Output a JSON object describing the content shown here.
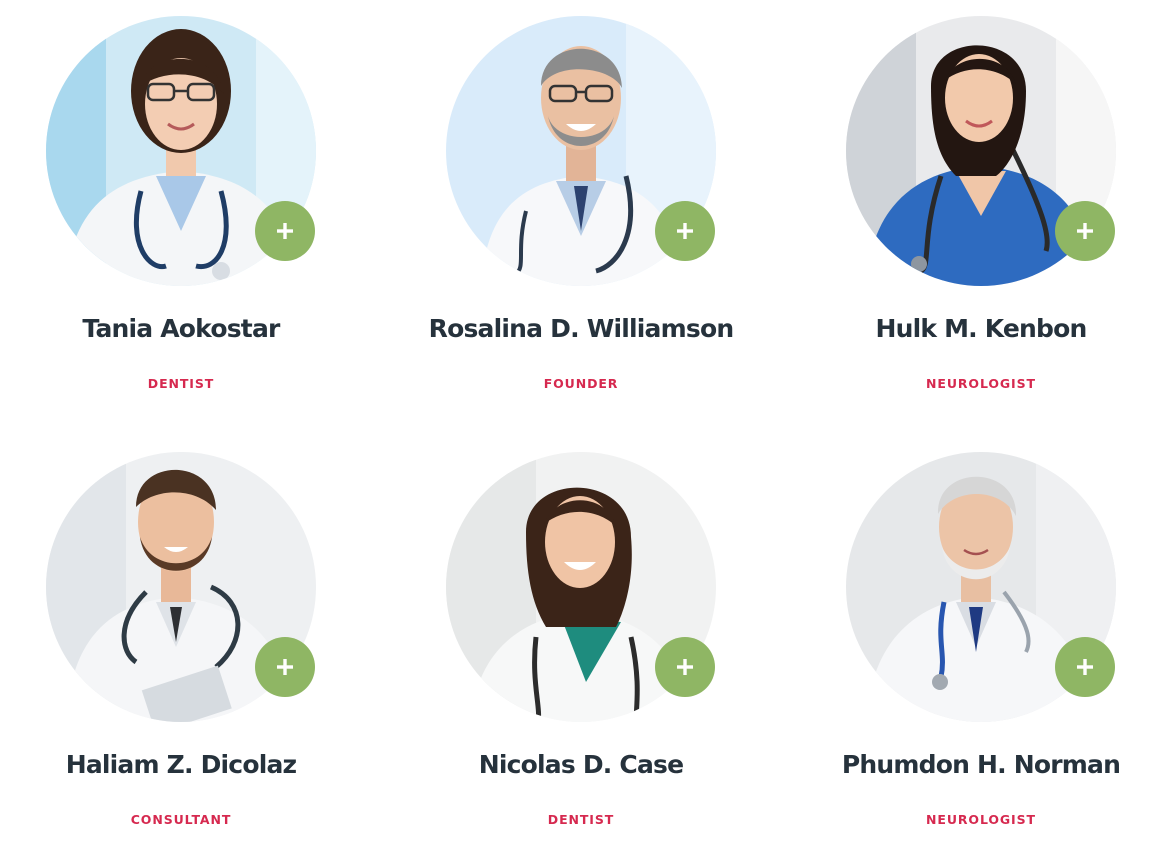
{
  "colors": {
    "name_text": "#26323c",
    "role_text": "#d6294f",
    "plus_button": "#8fb664",
    "background": "#ffffff"
  },
  "plus_icon": "plus-icon",
  "team": [
    {
      "name": "Tania Aokostar",
      "role": "DENTIST",
      "photo": "female-doctor-glasses-photo"
    },
    {
      "name": "Rosalina D. Williamson",
      "role": "FOUNDER",
      "photo": "male-doctor-glasses-photo"
    },
    {
      "name": "Hulk M. Kenbon",
      "role": "NEUROLOGIST",
      "photo": "female-doctor-scrubs-photo"
    },
    {
      "name": "Haliam Z. Dicolaz",
      "role": "CONSULTANT",
      "photo": "male-doctor-beard-photo"
    },
    {
      "name": "Nicolas D. Case",
      "role": "DENTIST",
      "photo": "female-doctor-smiling-photo"
    },
    {
      "name": "Phumdon H. Norman",
      "role": "NEUROLOGIST",
      "photo": "senior-male-doctor-photo"
    }
  ]
}
